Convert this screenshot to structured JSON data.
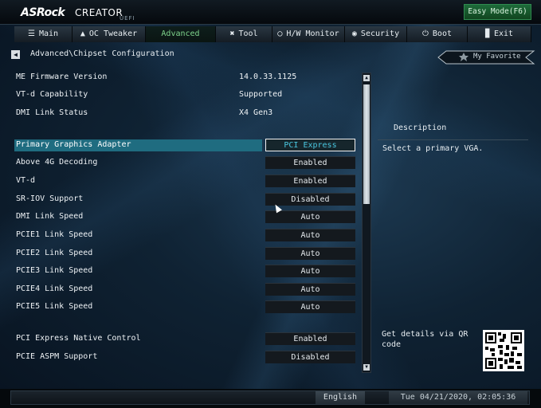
{
  "brand": {
    "name": "ASRock",
    "model": "CREATOR",
    "firmware": "UEFI"
  },
  "easy_mode_label": "Easy Mode(F6)",
  "nav": {
    "tabs": [
      {
        "label": "Main",
        "icon": "list-icon"
      },
      {
        "label": "OC Tweaker",
        "icon": "rocket-icon"
      },
      {
        "label": "Advanced",
        "icon": "",
        "active": true
      },
      {
        "label": "Tool",
        "icon": "tools-icon"
      },
      {
        "label": "H/W Monitor",
        "icon": "monitor-icon"
      },
      {
        "label": "Security",
        "icon": "shield-icon"
      },
      {
        "label": "Boot",
        "icon": "power-icon"
      },
      {
        "label": "Exit",
        "icon": "exit-icon"
      }
    ]
  },
  "breadcrumb": "Advanced\\Chipset Configuration",
  "favorite_label": "My Favorite",
  "info_rows": [
    {
      "label": "ME Firmware Version",
      "value": "14.0.33.1125"
    },
    {
      "label": "VT-d Capability",
      "value": "Supported"
    },
    {
      "label": "DMI Link Status",
      "value": "X4  Gen3"
    }
  ],
  "settings": [
    {
      "label": "Primary Graphics Adapter",
      "value": "PCI Express",
      "selected": true
    },
    {
      "label": "Above 4G Decoding",
      "value": "Enabled"
    },
    {
      "label": "VT-d",
      "value": "Enabled"
    },
    {
      "label": "SR-IOV Support",
      "value": "Disabled"
    },
    {
      "label": "DMI Link Speed",
      "value": "Auto"
    },
    {
      "label": "PCIE1 Link Speed",
      "value": "Auto"
    },
    {
      "label": "PCIE2 Link Speed",
      "value": "Auto"
    },
    {
      "label": "PCIE3 Link Speed",
      "value": "Auto"
    },
    {
      "label": "PCIE4 Link Speed",
      "value": "Auto"
    },
    {
      "label": "PCIE5 Link Speed",
      "value": "Auto"
    },
    {
      "label": "PCI Express Native Control",
      "value": "Enabled"
    },
    {
      "label": "PCIE ASPM Support",
      "value": "Disabled"
    }
  ],
  "description": {
    "title": "Description",
    "text": "Select a primary VGA.",
    "qr_text": "Get details via QR code"
  },
  "status_bar": {
    "language": "English",
    "datetime": "Tue 04/21/2020, 02:05:36"
  },
  "colors": {
    "highlight": "#1f6c80",
    "active_tab_text": "#7fd48c",
    "selected_value_text": "#49c7e0",
    "easy_mode": "#1e6b3a"
  }
}
